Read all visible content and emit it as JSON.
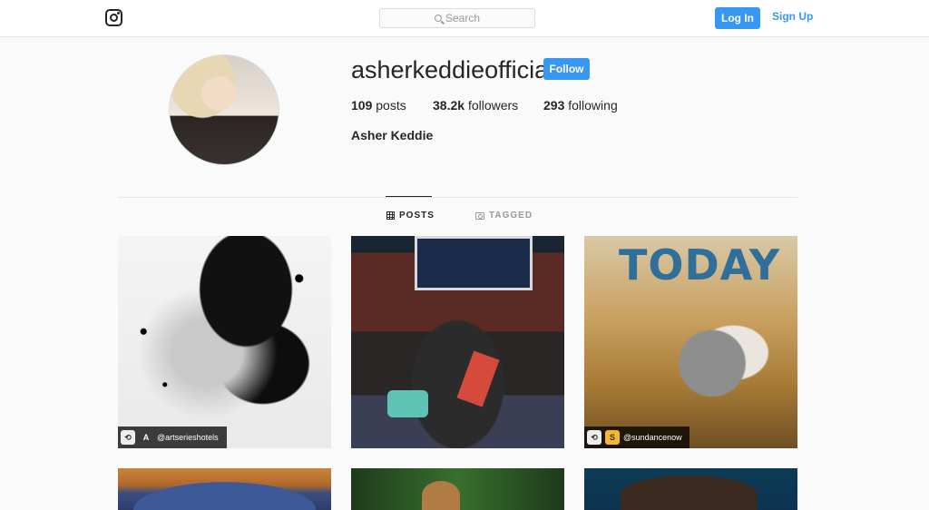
{
  "header": {
    "search_placeholder": "Search",
    "login_label": "Log In",
    "signup_label": "Sign Up"
  },
  "profile": {
    "username": "asherkeddieofficial",
    "follow_label": "Follow",
    "posts_count": "109",
    "posts_label": "posts",
    "followers_count": "38.2k",
    "followers_label": "followers",
    "following_count": "293",
    "following_label": "following",
    "full_name": "Asher Keddie"
  },
  "tabs": [
    {
      "label": "POSTS",
      "active": true
    },
    {
      "label": "TAGGED",
      "active": false
    }
  ],
  "posts": [
    {
      "credit": "@artserieshotels"
    },
    {
      "credit": ""
    },
    {
      "overlay_text": "TODAY",
      "credit": "@sundancenow"
    }
  ],
  "colors": {
    "accent": "#3897f0",
    "text": "#262626",
    "muted": "#999999",
    "background": "#fafafa"
  },
  "icons": [
    "instagram-logo-icon",
    "search-icon",
    "grid-icon",
    "tagged-icon"
  ]
}
